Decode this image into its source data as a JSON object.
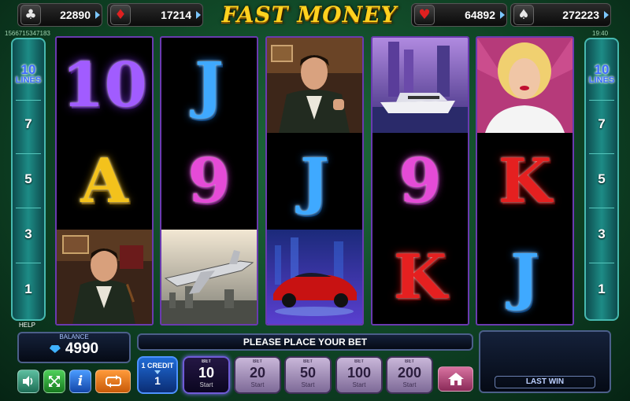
{
  "jackpots": [
    {
      "suit": "club",
      "glyph": "♣",
      "color": "#e8e8e8",
      "value": "22890"
    },
    {
      "suit": "diamond",
      "glyph": "♦",
      "color": "#e02020",
      "value": "17214"
    },
    {
      "suit": "heart",
      "glyph": "♥",
      "color": "#e02020",
      "value": "64892"
    },
    {
      "suit": "spade",
      "glyph": "♠",
      "color": "#e8e8e8",
      "value": "272223"
    }
  ],
  "logo": "FAST MONEY",
  "session_id": "1566715347183",
  "clock": "19:40",
  "lines": {
    "count": "10",
    "label": "LINES",
    "markers": [
      "7",
      "5",
      "3",
      "1"
    ]
  },
  "reels": [
    [
      "10",
      "A",
      "businessman"
    ],
    [
      "J",
      "9",
      "jet"
    ],
    [
      "businessman",
      "J",
      "sports-car"
    ],
    [
      "yacht",
      "9",
      "K"
    ],
    [
      "blonde-woman",
      "K",
      "J"
    ]
  ],
  "help_label": "HELP",
  "balance": {
    "label": "BALANCE",
    "value": "4990"
  },
  "message": "PLEASE PLACE YOUR BET",
  "last_win_label": "LAST WIN",
  "credit": {
    "label": "1 CREDIT",
    "value": "1"
  },
  "bets": [
    {
      "label": "BET",
      "value": "10",
      "sub": "Start",
      "active": true
    },
    {
      "label": "BET",
      "value": "20",
      "sub": "Start",
      "active": false
    },
    {
      "label": "BET",
      "value": "50",
      "sub": "Start",
      "active": false
    },
    {
      "label": "BET",
      "value": "100",
      "sub": "Start",
      "active": false
    },
    {
      "label": "BET",
      "value": "200",
      "sub": "Start",
      "active": false
    }
  ],
  "icons": {
    "sound": "speaker-icon",
    "fullscreen": "fullscreen-icon",
    "info": "info-icon",
    "autoplay": "autoplay-icon",
    "home": "home-icon"
  }
}
